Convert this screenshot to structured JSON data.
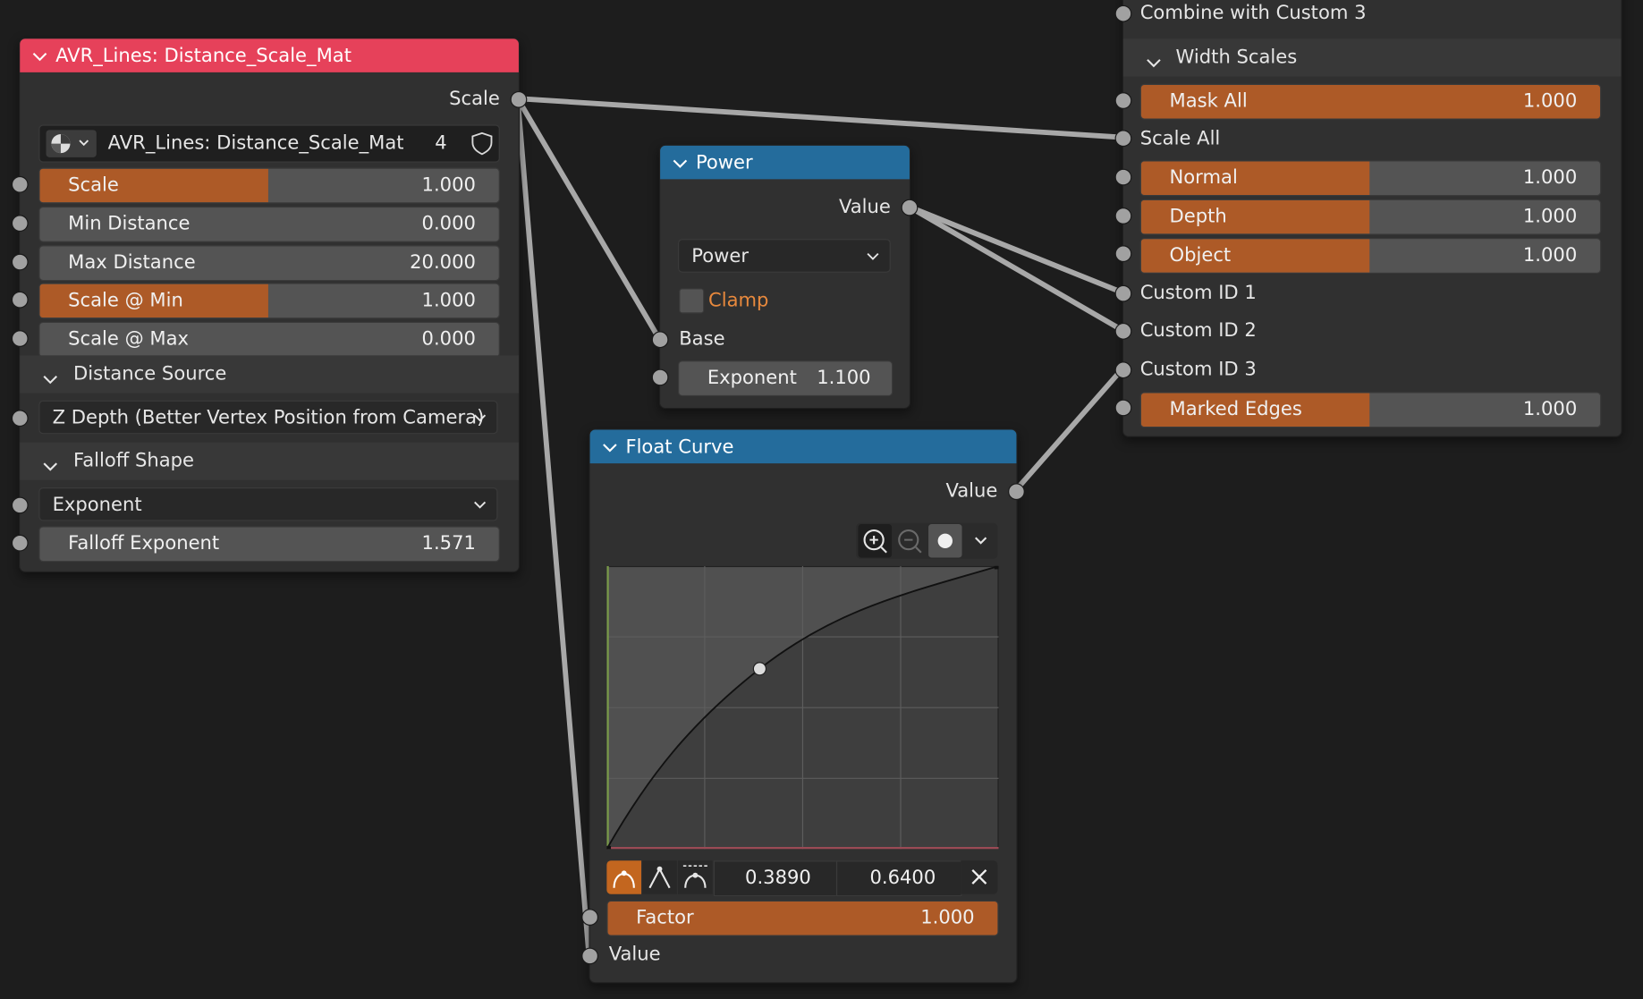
{
  "colors": {
    "background": "#1d1d1d",
    "node_body": "#303030",
    "group_header": "#e6415a",
    "converter_header": "#246c9c",
    "accent_fill": "#ad5a27",
    "socket": "#a1a1a1",
    "wire": "#a8a8a8"
  },
  "group_node": {
    "title": "AVR_Lines: Distance_Scale_Mat",
    "output_label": "Scale",
    "datablock_name": "AVR_Lines: Distance_Scale_Mat",
    "user_count": "4",
    "fields": [
      {
        "label": "Scale",
        "value": "1.000"
      },
      {
        "label": "Min Distance",
        "value": "0.000"
      },
      {
        "label": "Max Distance",
        "value": "20.000"
      },
      {
        "label": "Scale @ Min",
        "value": "1.000"
      },
      {
        "label": "Scale @ Max",
        "value": "0.000"
      }
    ],
    "distance_source_label": "Distance Source",
    "distance_source_value": "Z Depth (Better Vertex Position from Camera)",
    "falloff_shape_label": "Falloff Shape",
    "falloff_shape_value": "Exponent",
    "falloff_exponent_label": "Falloff Exponent",
    "falloff_exponent_value": "1.571"
  },
  "power_node": {
    "title": "Power",
    "output_label": "Value",
    "operation": "Power",
    "clamp_label": "Clamp",
    "base_label": "Base",
    "exponent_label": "Exponent",
    "exponent_value": "1.100"
  },
  "float_curve_node": {
    "title": "Float Curve",
    "output_label": "Value",
    "point_x": "0.3890",
    "point_y": "0.6400",
    "factor_label": "Factor",
    "factor_value": "1.000",
    "value_input_label": "Value"
  },
  "output_node": {
    "top_label": "Combine with Custom 3",
    "panel_label": "Width Scales",
    "mask_all_label": "Mask All",
    "mask_all_value": "1.000",
    "scale_all_label": "Scale All",
    "normal_label": "Normal",
    "normal_value": "1.000",
    "depth_label": "Depth",
    "depth_value": "1.000",
    "object_label": "Object",
    "object_value": "1.000",
    "custom1_label": "Custom ID 1",
    "custom2_label": "Custom ID 2",
    "custom3_label": "Custom ID 3",
    "marked_edges_label": "Marked Edges",
    "marked_edges_value": "1.000"
  }
}
